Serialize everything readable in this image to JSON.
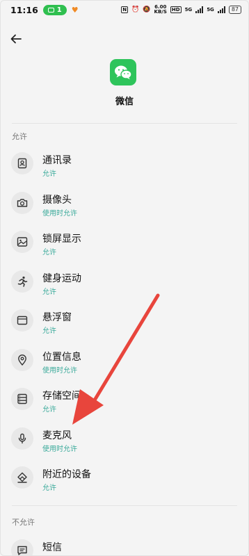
{
  "status_bar": {
    "time": "11:16",
    "pill_count": "1",
    "net_speed": "6.00\nKB/S",
    "net_type_1": "5G",
    "net_type_2": "5G",
    "hd": "HD",
    "battery": "87"
  },
  "header": {
    "app_name": "微信",
    "app_icon": "wechat-icon",
    "accent_color": "#2ec45b"
  },
  "sections": {
    "allowed_label": "允许",
    "not_allowed_label": "不允许"
  },
  "permissions": [
    {
      "title": "通讯录",
      "status": "允许",
      "icon": "contacts-icon"
    },
    {
      "title": "摄像头",
      "status": "使用时允许",
      "icon": "camera-icon"
    },
    {
      "title": "锁屏显示",
      "status": "允许",
      "icon": "image-icon"
    },
    {
      "title": "健身运动",
      "status": "允许",
      "icon": "running-icon"
    },
    {
      "title": "悬浮窗",
      "status": "允许",
      "icon": "window-icon"
    },
    {
      "title": "位置信息",
      "status": "使用时允许",
      "icon": "location-icon"
    },
    {
      "title": "存储空间",
      "status": "允许",
      "icon": "storage-icon"
    },
    {
      "title": "麦克风",
      "status": "使用时允许",
      "icon": "microphone-icon"
    },
    {
      "title": "附近的设备",
      "status": "允许",
      "icon": "nearby-devices-icon"
    }
  ],
  "denied": [
    {
      "title": "短信",
      "icon": "sms-icon"
    }
  ],
  "colors": {
    "status_text": "#3aaa9a",
    "annotation_arrow": "#e8453c"
  }
}
